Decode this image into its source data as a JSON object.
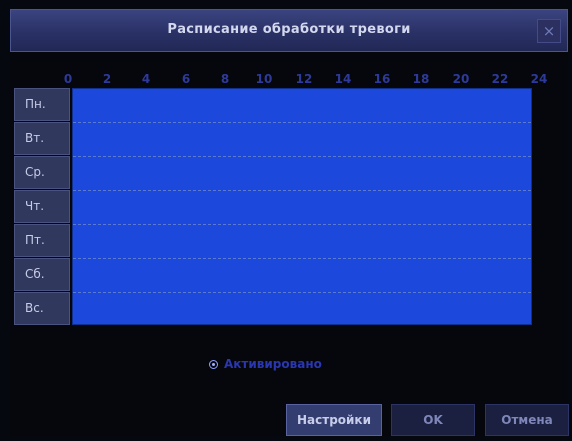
{
  "window": {
    "title": "Расписание обработки тревоги",
    "close_label": "×"
  },
  "schedule": {
    "hour_labels": [
      "0",
      "2",
      "4",
      "6",
      "8",
      "10",
      "12",
      "14",
      "16",
      "18",
      "20",
      "22",
      "24"
    ],
    "days": [
      "Пн.",
      "Вт.",
      "Ср.",
      "Чт.",
      "Пт.",
      "Сб.",
      "Вс."
    ],
    "grid_fill_color": "#1c48dc"
  },
  "option": {
    "label": "Активировано",
    "selected": true
  },
  "buttons": {
    "settings_label": "Настройки",
    "ok_label": "OK",
    "cancel_label": "Отмена"
  }
}
